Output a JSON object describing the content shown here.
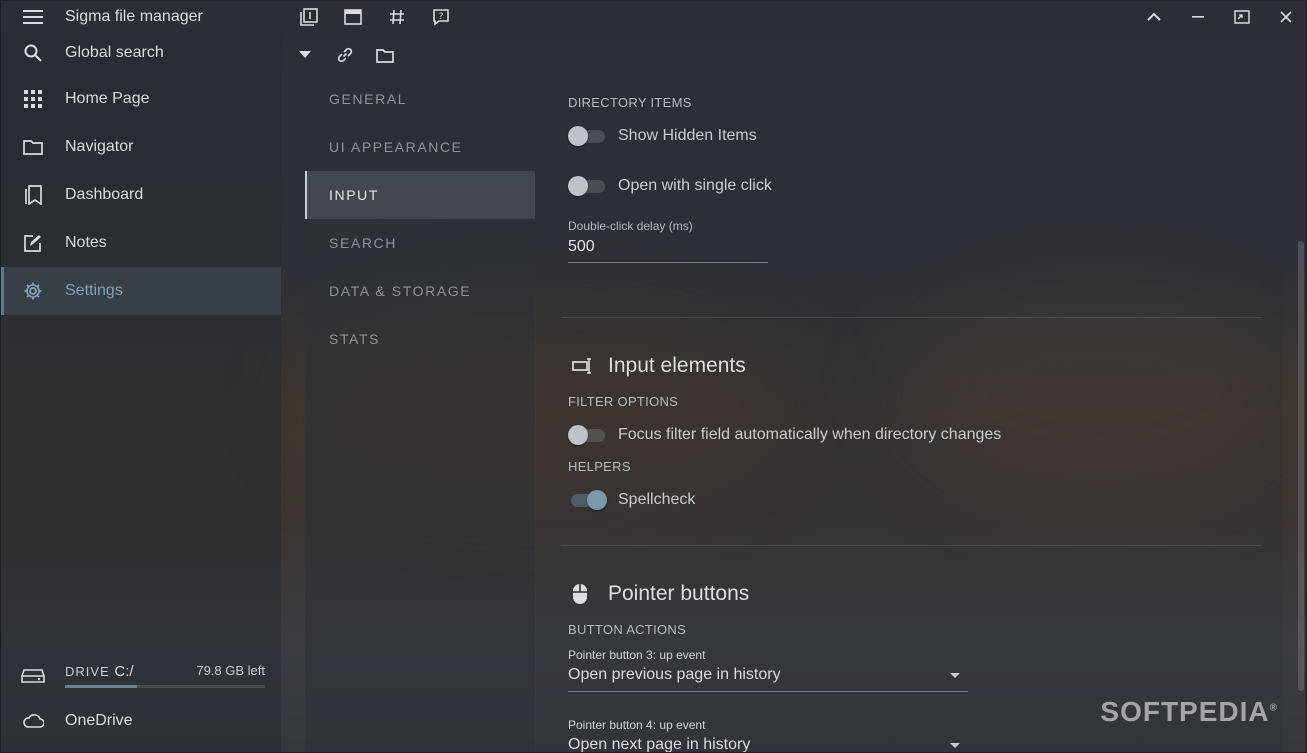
{
  "app": {
    "title": "Sigma file manager"
  },
  "sidebar": {
    "search_label": "Global search",
    "items": [
      {
        "label": "Home Page",
        "icon": "grid-icon"
      },
      {
        "label": "Navigator",
        "icon": "folder-icon"
      },
      {
        "label": "Dashboard",
        "icon": "bookmarks-icon"
      },
      {
        "label": "Notes",
        "icon": "edit-icon"
      },
      {
        "label": "Settings",
        "icon": "gear-icon",
        "active": true
      }
    ],
    "drive": {
      "prefix": "DRIVE",
      "name": "C:/",
      "free": "79.8 GB left",
      "used_fraction": 0.36
    },
    "onedrive": "OneDrive"
  },
  "settings_nav": {
    "items": [
      "GENERAL",
      "UI APPEARANCE",
      "INPUT",
      "SEARCH",
      "DATA & STORAGE",
      "STATS"
    ],
    "active": "INPUT"
  },
  "content": {
    "directory_items": {
      "subheader": "DIRECTORY ITEMS",
      "show_hidden": {
        "label": "Show Hidden Items",
        "on": false
      },
      "single_click": {
        "label": "Open with single click",
        "on": false
      },
      "delay": {
        "label": "Double-click delay (ms)",
        "value": "500"
      }
    },
    "input_elements": {
      "title": "Input elements",
      "filter_subheader": "FILTER OPTIONS",
      "focus_filter": {
        "label": "Focus filter field automatically when directory changes",
        "on": false
      },
      "helpers_subheader": "HELPERS",
      "spellcheck": {
        "label": "Spellcheck",
        "on": true
      }
    },
    "pointer_buttons": {
      "title": "Pointer buttons",
      "subheader": "BUTTON ACTIONS",
      "button3": {
        "label": "Pointer button 3: up event",
        "value": "Open previous page in history"
      },
      "button4": {
        "label": "Pointer button 4: up event",
        "value": "Open next page in history"
      }
    }
  },
  "watermark": "SOFTPEDIA",
  "watermark_mark": "®"
}
